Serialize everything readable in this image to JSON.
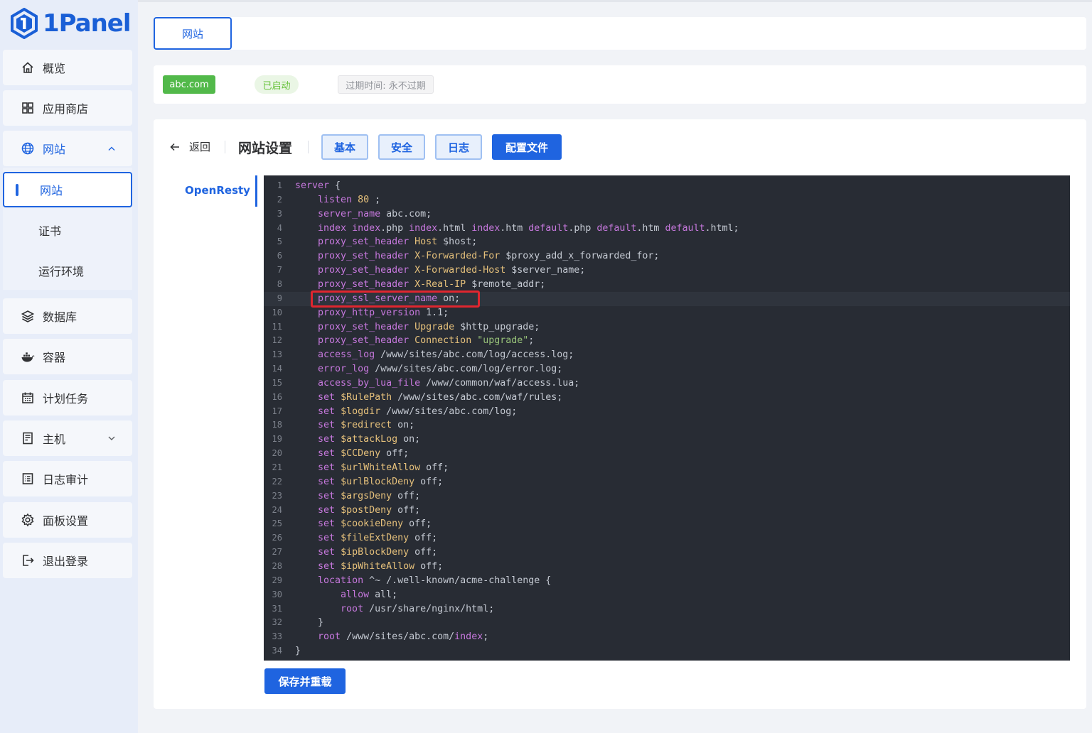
{
  "app": {
    "logo_text": "1Panel"
  },
  "sidebar": {
    "items": [
      {
        "label": "概览",
        "icon": "home-icon"
      },
      {
        "label": "应用商店",
        "icon": "grid-icon"
      },
      {
        "label": "网站",
        "icon": "globe-icon"
      },
      {
        "label": "数据库",
        "icon": "layers-icon"
      },
      {
        "label": "容器",
        "icon": "docker-icon"
      },
      {
        "label": "计划任务",
        "icon": "calendar-icon"
      },
      {
        "label": "主机",
        "icon": "host-icon"
      },
      {
        "label": "日志审计",
        "icon": "log-icon"
      },
      {
        "label": "面板设置",
        "icon": "gear-icon"
      },
      {
        "label": "退出登录",
        "icon": "logout-icon"
      }
    ],
    "website_submenu": [
      {
        "label": "网站"
      },
      {
        "label": "证书"
      },
      {
        "label": "运行环境"
      }
    ]
  },
  "header": {
    "tab_label": "网站"
  },
  "site_info": {
    "domain": "abc.com",
    "status": "已启动",
    "expire": "过期时间: 永不过期"
  },
  "toolbar": {
    "back_label": "返回",
    "title": "网站设置",
    "tabs": [
      "基本",
      "安全",
      "日志",
      "配置文件"
    ],
    "active_tab": "配置文件"
  },
  "server_tab": "OpenResty",
  "editor": {
    "highlighted_line": 9,
    "lines": [
      [
        [
          "kw",
          "server"
        ],
        [
          "t",
          " {"
        ]
      ],
      [
        [
          "t",
          "    "
        ],
        [
          "kw",
          "listen"
        ],
        [
          "t",
          " "
        ],
        [
          "num",
          "80"
        ],
        [
          "t",
          " ;"
        ]
      ],
      [
        [
          "t",
          "    "
        ],
        [
          "kw",
          "server_name"
        ],
        [
          "t",
          " abc.com;"
        ]
      ],
      [
        [
          "t",
          "    "
        ],
        [
          "kw",
          "index"
        ],
        [
          "t",
          " "
        ],
        [
          "kw",
          "index"
        ],
        [
          "t",
          ".php "
        ],
        [
          "kw",
          "index"
        ],
        [
          "t",
          ".html "
        ],
        [
          "kw",
          "index"
        ],
        [
          "t",
          ".htm "
        ],
        [
          "kw",
          "default"
        ],
        [
          "t",
          ".php "
        ],
        [
          "kw",
          "default"
        ],
        [
          "t",
          ".htm "
        ],
        [
          "kw",
          "default"
        ],
        [
          "t",
          ".html;"
        ]
      ],
      [
        [
          "t",
          "    "
        ],
        [
          "kw",
          "proxy_set_header"
        ],
        [
          "t",
          " "
        ],
        [
          "var",
          "Host"
        ],
        [
          "t",
          " $host;"
        ]
      ],
      [
        [
          "t",
          "    "
        ],
        [
          "kw",
          "proxy_set_header"
        ],
        [
          "t",
          " "
        ],
        [
          "var",
          "X-Forwarded-For"
        ],
        [
          "t",
          " $proxy_add_x_forwarded_for;"
        ]
      ],
      [
        [
          "t",
          "    "
        ],
        [
          "kw",
          "proxy_set_header"
        ],
        [
          "t",
          " "
        ],
        [
          "var",
          "X-Forwarded-Host"
        ],
        [
          "t",
          " $server_name;"
        ]
      ],
      [
        [
          "t",
          "    "
        ],
        [
          "kw",
          "proxy_set_header"
        ],
        [
          "t",
          " "
        ],
        [
          "var",
          "X-Real-IP"
        ],
        [
          "t",
          " $remote_addr;"
        ]
      ],
      [
        [
          "t",
          "    "
        ],
        [
          "kw",
          "proxy_ssl_server_name"
        ],
        [
          "t",
          " on;"
        ]
      ],
      [
        [
          "t",
          "    "
        ],
        [
          "kw",
          "proxy_http_version"
        ],
        [
          "t",
          " 1.1;"
        ]
      ],
      [
        [
          "t",
          "    "
        ],
        [
          "kw",
          "proxy_set_header"
        ],
        [
          "t",
          " "
        ],
        [
          "var",
          "Upgrade"
        ],
        [
          "t",
          " $http_upgrade;"
        ]
      ],
      [
        [
          "t",
          "    "
        ],
        [
          "kw",
          "proxy_set_header"
        ],
        [
          "t",
          " "
        ],
        [
          "var",
          "Connection"
        ],
        [
          "t",
          " "
        ],
        [
          "str",
          "\"upgrade\""
        ],
        [
          "t",
          ";"
        ]
      ],
      [
        [
          "t",
          "    "
        ],
        [
          "kw",
          "access_log"
        ],
        [
          "t",
          " /www/sites/abc.com/log/access.log;"
        ]
      ],
      [
        [
          "t",
          "    "
        ],
        [
          "kw",
          "error_log"
        ],
        [
          "t",
          " /www/sites/abc.com/log/error.log;"
        ]
      ],
      [
        [
          "t",
          "    "
        ],
        [
          "kw",
          "access_by_lua_file"
        ],
        [
          "t",
          " /www/common/waf/access.lua;"
        ]
      ],
      [
        [
          "t",
          "    "
        ],
        [
          "kw",
          "set"
        ],
        [
          "t",
          " "
        ],
        [
          "var",
          "$RulePath"
        ],
        [
          "t",
          " /www/sites/abc.com/waf/rules;"
        ]
      ],
      [
        [
          "t",
          "    "
        ],
        [
          "kw",
          "set"
        ],
        [
          "t",
          " "
        ],
        [
          "var",
          "$logdir"
        ],
        [
          "t",
          " /www/sites/abc.com/log;"
        ]
      ],
      [
        [
          "t",
          "    "
        ],
        [
          "kw",
          "set"
        ],
        [
          "t",
          " "
        ],
        [
          "var",
          "$redirect"
        ],
        [
          "t",
          " on;"
        ]
      ],
      [
        [
          "t",
          "    "
        ],
        [
          "kw",
          "set"
        ],
        [
          "t",
          " "
        ],
        [
          "var",
          "$attackLog"
        ],
        [
          "t",
          " on;"
        ]
      ],
      [
        [
          "t",
          "    "
        ],
        [
          "kw",
          "set"
        ],
        [
          "t",
          " "
        ],
        [
          "var",
          "$CCDeny"
        ],
        [
          "t",
          " off;"
        ]
      ],
      [
        [
          "t",
          "    "
        ],
        [
          "kw",
          "set"
        ],
        [
          "t",
          " "
        ],
        [
          "var",
          "$urlWhiteAllow"
        ],
        [
          "t",
          " off;"
        ]
      ],
      [
        [
          "t",
          "    "
        ],
        [
          "kw",
          "set"
        ],
        [
          "t",
          " "
        ],
        [
          "var",
          "$urlBlockDeny"
        ],
        [
          "t",
          " off;"
        ]
      ],
      [
        [
          "t",
          "    "
        ],
        [
          "kw",
          "set"
        ],
        [
          "t",
          " "
        ],
        [
          "var",
          "$argsDeny"
        ],
        [
          "t",
          " off;"
        ]
      ],
      [
        [
          "t",
          "    "
        ],
        [
          "kw",
          "set"
        ],
        [
          "t",
          " "
        ],
        [
          "var",
          "$postDeny"
        ],
        [
          "t",
          " off;"
        ]
      ],
      [
        [
          "t",
          "    "
        ],
        [
          "kw",
          "set"
        ],
        [
          "t",
          " "
        ],
        [
          "var",
          "$cookieDeny"
        ],
        [
          "t",
          " off;"
        ]
      ],
      [
        [
          "t",
          "    "
        ],
        [
          "kw",
          "set"
        ],
        [
          "t",
          " "
        ],
        [
          "var",
          "$fileExtDeny"
        ],
        [
          "t",
          " off;"
        ]
      ],
      [
        [
          "t",
          "    "
        ],
        [
          "kw",
          "set"
        ],
        [
          "t",
          " "
        ],
        [
          "var",
          "$ipBlockDeny"
        ],
        [
          "t",
          " off;"
        ]
      ],
      [
        [
          "t",
          "    "
        ],
        [
          "kw",
          "set"
        ],
        [
          "t",
          " "
        ],
        [
          "var",
          "$ipWhiteAllow"
        ],
        [
          "t",
          " off;"
        ]
      ],
      [
        [
          "t",
          "    "
        ],
        [
          "kw",
          "location"
        ],
        [
          "t",
          " ^~ /.well-known/acme-challenge {"
        ]
      ],
      [
        [
          "t",
          "        "
        ],
        [
          "kw",
          "allow"
        ],
        [
          "t",
          " all;"
        ]
      ],
      [
        [
          "t",
          "        "
        ],
        [
          "kw",
          "root"
        ],
        [
          "t",
          " /usr/share/nginx/html;"
        ]
      ],
      [
        [
          "t",
          "    }"
        ]
      ],
      [
        [
          "t",
          "    "
        ],
        [
          "kw",
          "root"
        ],
        [
          "t",
          " /www/sites/abc.com/"
        ],
        [
          "kw",
          "index"
        ],
        [
          "t",
          ";"
        ]
      ],
      [
        [
          "t",
          "}"
        ]
      ]
    ]
  },
  "save_button_label": "保存并重载",
  "colors": {
    "primary": "#1f64e0",
    "success": "#52b94a",
    "editor_bg": "#282c34",
    "keyword": "#c678dd",
    "variable": "#e5c07b",
    "string": "#98c379",
    "number": "#e5c07b",
    "highlight_box": "#e0262f"
  }
}
